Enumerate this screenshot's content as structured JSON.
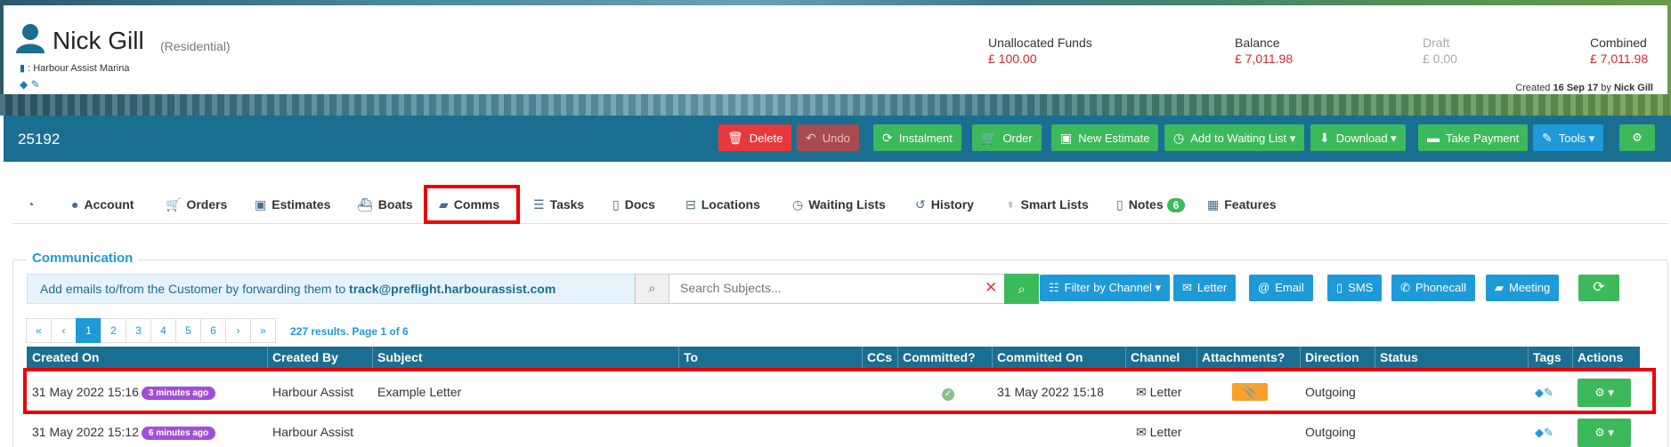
{
  "customer": {
    "name": "Nick Gill",
    "type": "(Residential)",
    "marina": ": Harbour Assist Marina"
  },
  "finance": {
    "unallocated_label": "Unallocated Funds",
    "unallocated_value": "£ 100.00",
    "balance_label": "Balance",
    "balance_value": "£ 7,011.98",
    "draft_label": "Draft",
    "draft_value": "£ 0.00",
    "combined_label": "Combined",
    "combined_value": "£ 7,011.98"
  },
  "created": {
    "prefix": "Created",
    "date": "16 Sep 17",
    "by": "by",
    "user": "Nick Gill"
  },
  "toolbar": {
    "account_number": "25192",
    "delete": "Delete",
    "undo": "Undo",
    "instalment": "Instalment",
    "order": "Order",
    "new_estimate": "New Estimate",
    "waiting_list": "Add to Waiting List",
    "download": "Download",
    "take_payment": "Take Payment",
    "tools": "Tools"
  },
  "tabs": {
    "account": "Account",
    "orders": "Orders",
    "estimates": "Estimates",
    "boats": "Boats",
    "comms": "Comms",
    "tasks": "Tasks",
    "docs": "Docs",
    "locations": "Locations",
    "waiting_lists": "Waiting Lists",
    "history": "History",
    "smart_lists": "Smart Lists",
    "notes": "Notes",
    "notes_count": "6",
    "features": "Features"
  },
  "communication": {
    "title": "Communication",
    "info_text": "Add emails to/from the Customer by forwarding them to ",
    "info_email": "track@preflight.harbourassist.com",
    "search_placeholder": "Search Subjects...",
    "filter_channel": "Filter by Channel",
    "letter": "Letter",
    "email": "Email",
    "sms": "SMS",
    "phonecall": "Phonecall",
    "meeting": "Meeting"
  },
  "pagination": {
    "first": "«",
    "prev": "‹",
    "pages": [
      "1",
      "2",
      "3",
      "4",
      "5",
      "6"
    ],
    "next": "›",
    "last": "»",
    "results": "227 results. Page 1 of 6"
  },
  "table": {
    "headers": {
      "created_on": "Created On",
      "created_by": "Created By",
      "subject": "Subject",
      "to": "To",
      "ccs": "CCs",
      "committed": "Committed?",
      "committed_on": "Committed On",
      "channel": "Channel",
      "attachments": "Attachments?",
      "direction": "Direction",
      "status": "Status",
      "tags": "Tags",
      "actions": "Actions"
    },
    "rows": [
      {
        "created_on": "31 May 2022 15:16",
        "age": "3 minutes ago",
        "created_by": "Harbour Assist",
        "subject": "Example Letter",
        "committed_on": "31 May 2022 15:18",
        "channel": "Letter",
        "direction": "Outgoing"
      },
      {
        "created_on": "31 May 2022 15:12",
        "age": "6 minutes ago",
        "created_by": "Harbour Assist",
        "subject": "",
        "committed_on": "",
        "channel": "Letter",
        "direction": "Outgoing"
      }
    ]
  }
}
